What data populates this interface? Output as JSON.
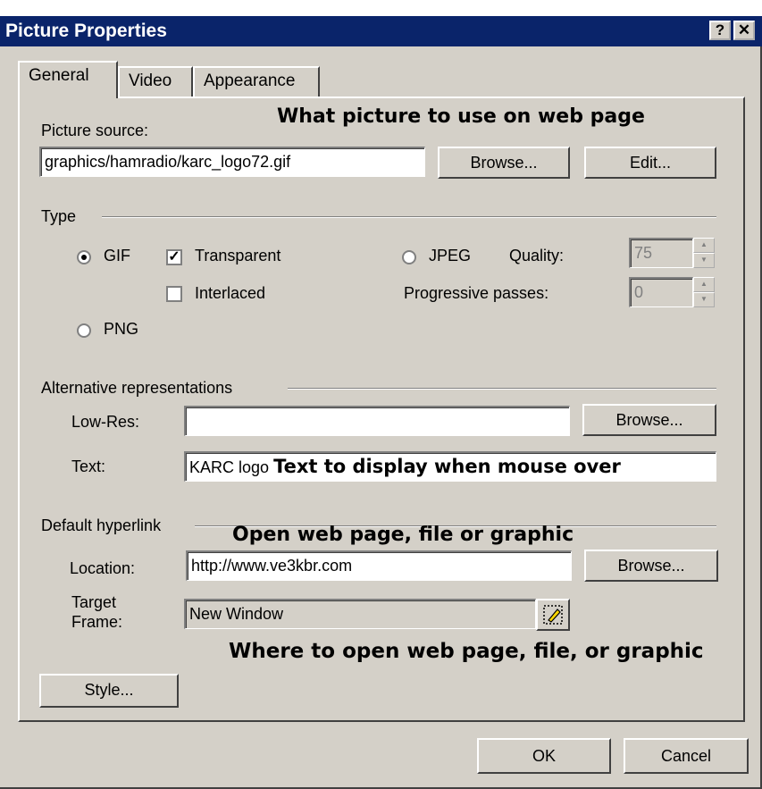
{
  "window": {
    "title": "Picture Properties",
    "help_label": "?",
    "close_label": "✕"
  },
  "tabs": [
    {
      "label": "General"
    },
    {
      "label": "Video"
    },
    {
      "label": "Appearance"
    }
  ],
  "picture_source": {
    "label": "Picture source:",
    "value": "graphics/hamradio/karc_logo72.gif",
    "browse_label": "Browse...",
    "edit_label": "Edit...",
    "annotation": "What picture to use on web page"
  },
  "type_group": {
    "title": "Type",
    "gif_label": "GIF",
    "transparent_label": "Transparent",
    "interlaced_label": "Interlaced",
    "png_label": "PNG",
    "jpeg_label": "JPEG",
    "quality_label": "Quality:",
    "quality_value": "75",
    "progressive_label": "Progressive passes:",
    "progressive_value": "0"
  },
  "alt_group": {
    "title": "Alternative representations",
    "lowres_label": "Low-Res:",
    "lowres_value": "",
    "lowres_browse": "Browse...",
    "text_label": "Text:",
    "text_value": "KARC logo",
    "text_annotation": "Text to display when mouse over"
  },
  "hyperlink_group": {
    "title": "Default hyperlink",
    "annotation": "Open web page, file or  graphic",
    "location_label": "Location:",
    "location_value": "http://www.ve3kbr.com",
    "location_browse": "Browse...",
    "target_label_1": "Target",
    "target_label_2": "Frame:",
    "target_value": "New Window",
    "target_annotation": "Where to open web page, file, or graphic"
  },
  "style_button": "Style...",
  "footer": {
    "ok_label": "OK",
    "cancel_label": "Cancel"
  }
}
